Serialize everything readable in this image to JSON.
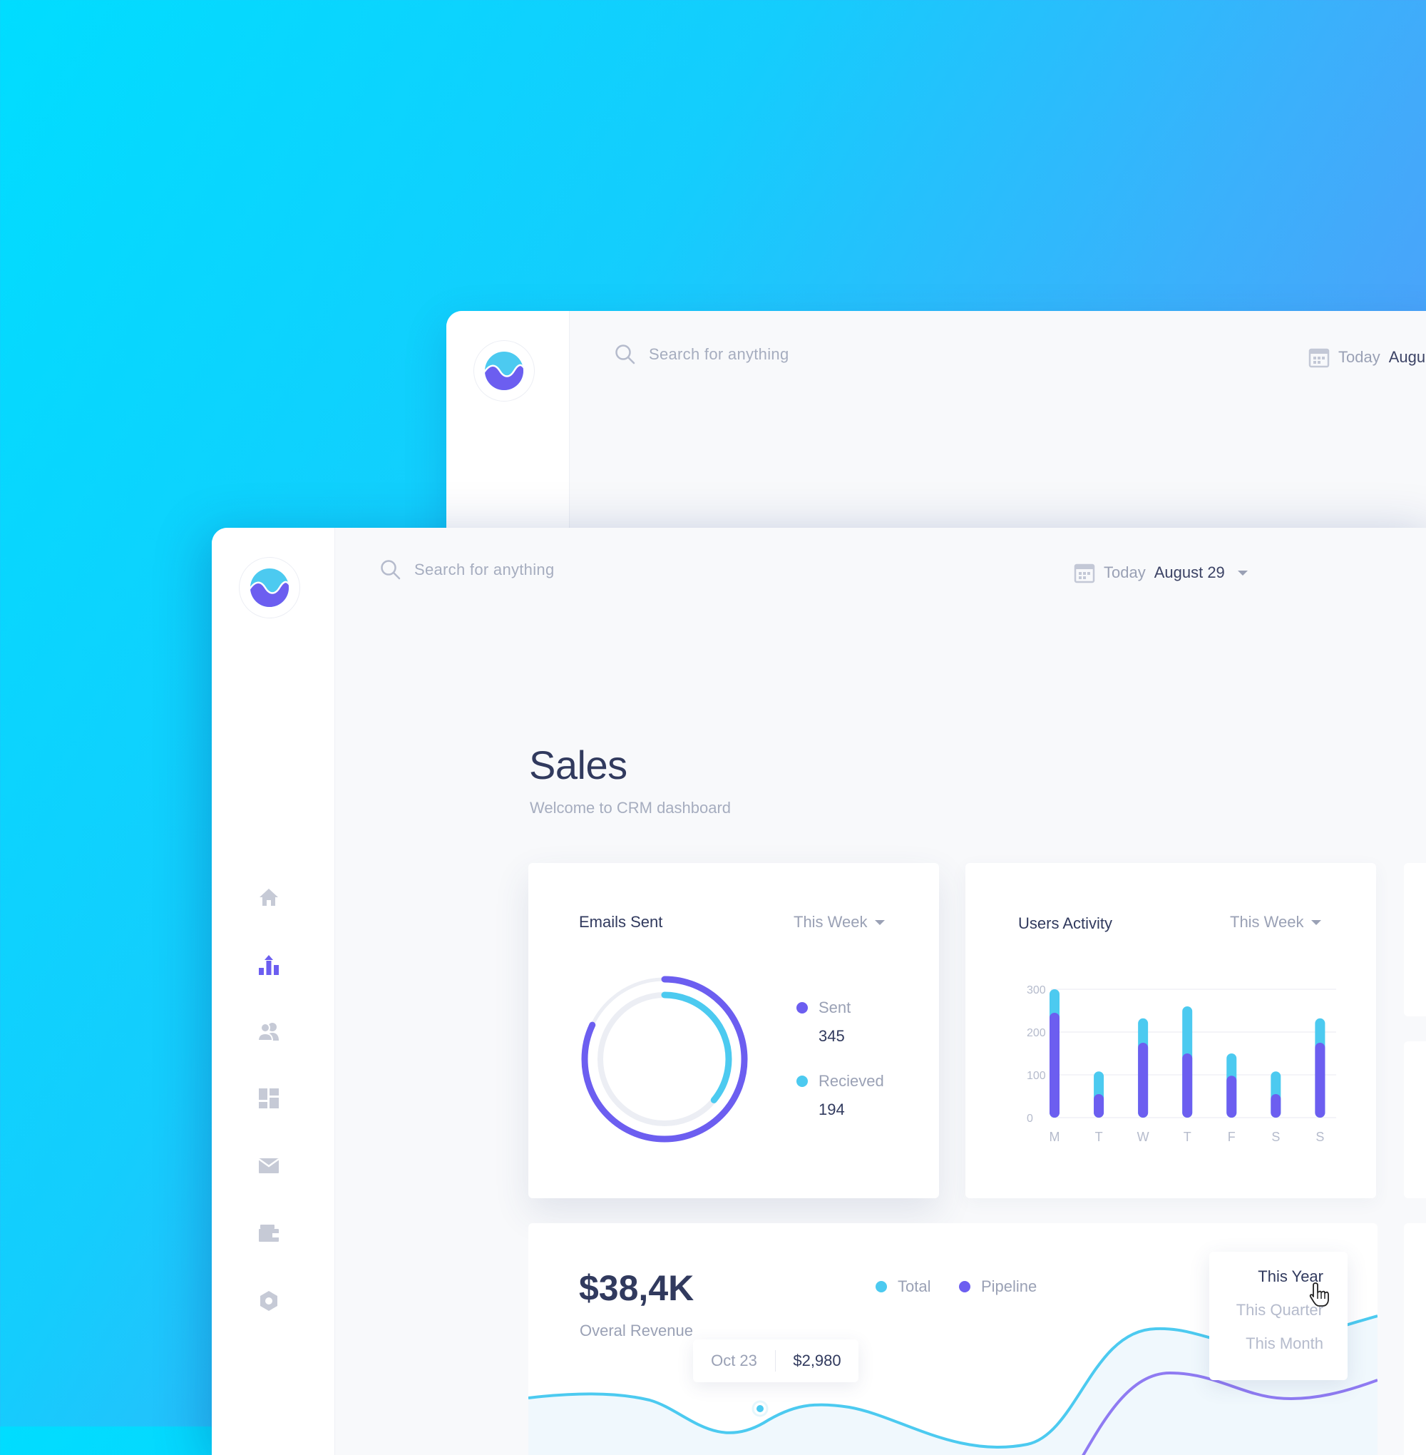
{
  "app": {
    "search_placeholder": "Search for anything",
    "date_prefix": "Today",
    "date_value": "August 29",
    "date_value_partial": "Augu"
  },
  "colors": {
    "primary_purple": "#6c5ef0",
    "accent_cyan": "#4ccaf0",
    "track_gray": "#eceef4",
    "text_dark": "#313a5e",
    "text_muted": "#a6adbf"
  },
  "sidebar": {
    "items": [
      {
        "icon": "home-icon",
        "active": false
      },
      {
        "icon": "chart-icon",
        "active": true
      },
      {
        "icon": "users-icon",
        "active": false
      },
      {
        "icon": "dashboard-icon",
        "active": false
      },
      {
        "icon": "mail-icon",
        "active": false
      },
      {
        "icon": "wallet-icon",
        "active": false
      },
      {
        "icon": "settings-icon",
        "active": false
      }
    ]
  },
  "page": {
    "title": "Sales",
    "subtitle": "Welcome to CRM dashboard"
  },
  "emails_card": {
    "title": "Emails Sent",
    "filter": "This Week",
    "legend": [
      {
        "label": "Sent",
        "value": "345",
        "color": "#6c5ef0"
      },
      {
        "label": "Recieved",
        "value": "194",
        "color": "#4ccaf0"
      }
    ]
  },
  "activity_card": {
    "title": "Users Activity",
    "filter": "This Week"
  },
  "revenue_card": {
    "value": "$38,4K",
    "label": "Overal Revenue",
    "legend": [
      {
        "label": "Total",
        "color": "#4ccaf0"
      },
      {
        "label": "Pipeline",
        "color": "#6c5ef0"
      }
    ],
    "tooltip": {
      "date": "Oct 23",
      "value": "$2,980"
    },
    "dropdown": [
      "This Year",
      "This Quarter",
      "This Month"
    ],
    "dropdown_selected": "This Year"
  },
  "chart_data": [
    {
      "type": "pie",
      "title": "Emails Sent",
      "categories": [
        "Sent",
        "Recieved"
      ],
      "values": [
        345,
        194
      ]
    },
    {
      "type": "bar",
      "title": "Users Activity",
      "categories": [
        "M",
        "T",
        "W",
        "T",
        "F",
        "S",
        "S"
      ],
      "yticks": [
        0,
        100,
        200,
        300
      ],
      "ylim": [
        0,
        300
      ],
      "series": [
        {
          "color": "#6c5ef0",
          "values": [
            245,
            55,
            175,
            150,
            98,
            55,
            175
          ]
        },
        {
          "color": "#4ccaf0",
          "values": [
            300,
            108,
            232,
            260,
            150,
            108,
            232
          ]
        }
      ]
    }
  ]
}
